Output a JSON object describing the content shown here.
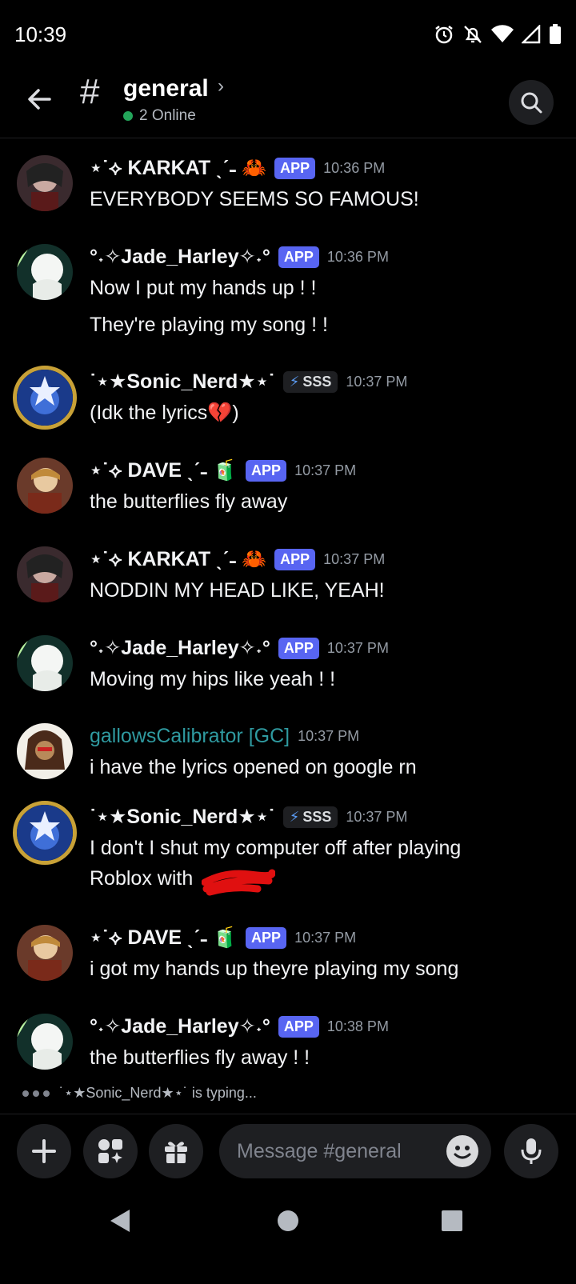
{
  "status": {
    "time": "10:39"
  },
  "channel": {
    "name": "general",
    "online": "2 Online"
  },
  "messages": [
    {
      "user": "⋆˙⟡ KARKAT ˎˊ˗ 🦀",
      "badge": "APP",
      "time": "10:36 PM",
      "lines": [
        "EVERYBODY SEEMS SO FAMOUS!"
      ]
    },
    {
      "user": "°˖✧Jade_Harley✧˖°",
      "badge": "APP",
      "time": "10:36 PM",
      "lines": [
        "Now I put my hands up ! !",
        "They're playing my song ! !"
      ]
    },
    {
      "user": "˙⋆★Sonic_Nerd★⋆˙",
      "tag": "SSS",
      "time": "10:37 PM",
      "lines": [
        "(Idk the lyrics💔)"
      ]
    },
    {
      "user": "⋆˙⟡ DAVE ˎˊ˗ 🧃",
      "badge": "APP",
      "time": "10:37 PM",
      "lines": [
        "the butterflies fly away"
      ]
    },
    {
      "user": "⋆˙⟡ KARKAT ˎˊ˗ 🦀",
      "badge": "APP",
      "time": "10:37 PM",
      "lines": [
        "NODDIN MY HEAD LIKE, YEAH!"
      ]
    },
    {
      "user": "°˖✧Jade_Harley✧˖°",
      "badge": "APP",
      "time": "10:37 PM",
      "lines": [
        "Moving my hips like yeah ! !"
      ]
    },
    {
      "user": "gallowsCalibrator [GC]",
      "time": "10:37 PM",
      "lines": [
        "i have the lyrics opened on google rn"
      ]
    },
    {
      "user": "˙⋆★Sonic_Nerd★⋆˙",
      "tag": "SSS",
      "time": "10:37 PM",
      "lines": [
        "I don't I shut my computer off after playing Roblox with"
      ]
    },
    {
      "user": "⋆˙⟡ DAVE ˎˊ˗ 🧃",
      "badge": "APP",
      "time": "10:37 PM",
      "lines": [
        "i got my hands up theyre playing my song"
      ]
    },
    {
      "user": "°˖✧Jade_Harley✧˖°",
      "badge": "APP",
      "time": "10:38 PM",
      "lines": [
        "the butterflies fly away ! !"
      ]
    }
  ],
  "typing": "˙⋆★Sonic_Nerd★⋆˙ is typing...",
  "composer": {
    "placeholder": "Message #general"
  },
  "colors": {
    "app_badge": "#5865f2",
    "online": "#23a55a",
    "teal_name": "#2f9aa0",
    "redaction": "#e01010"
  }
}
